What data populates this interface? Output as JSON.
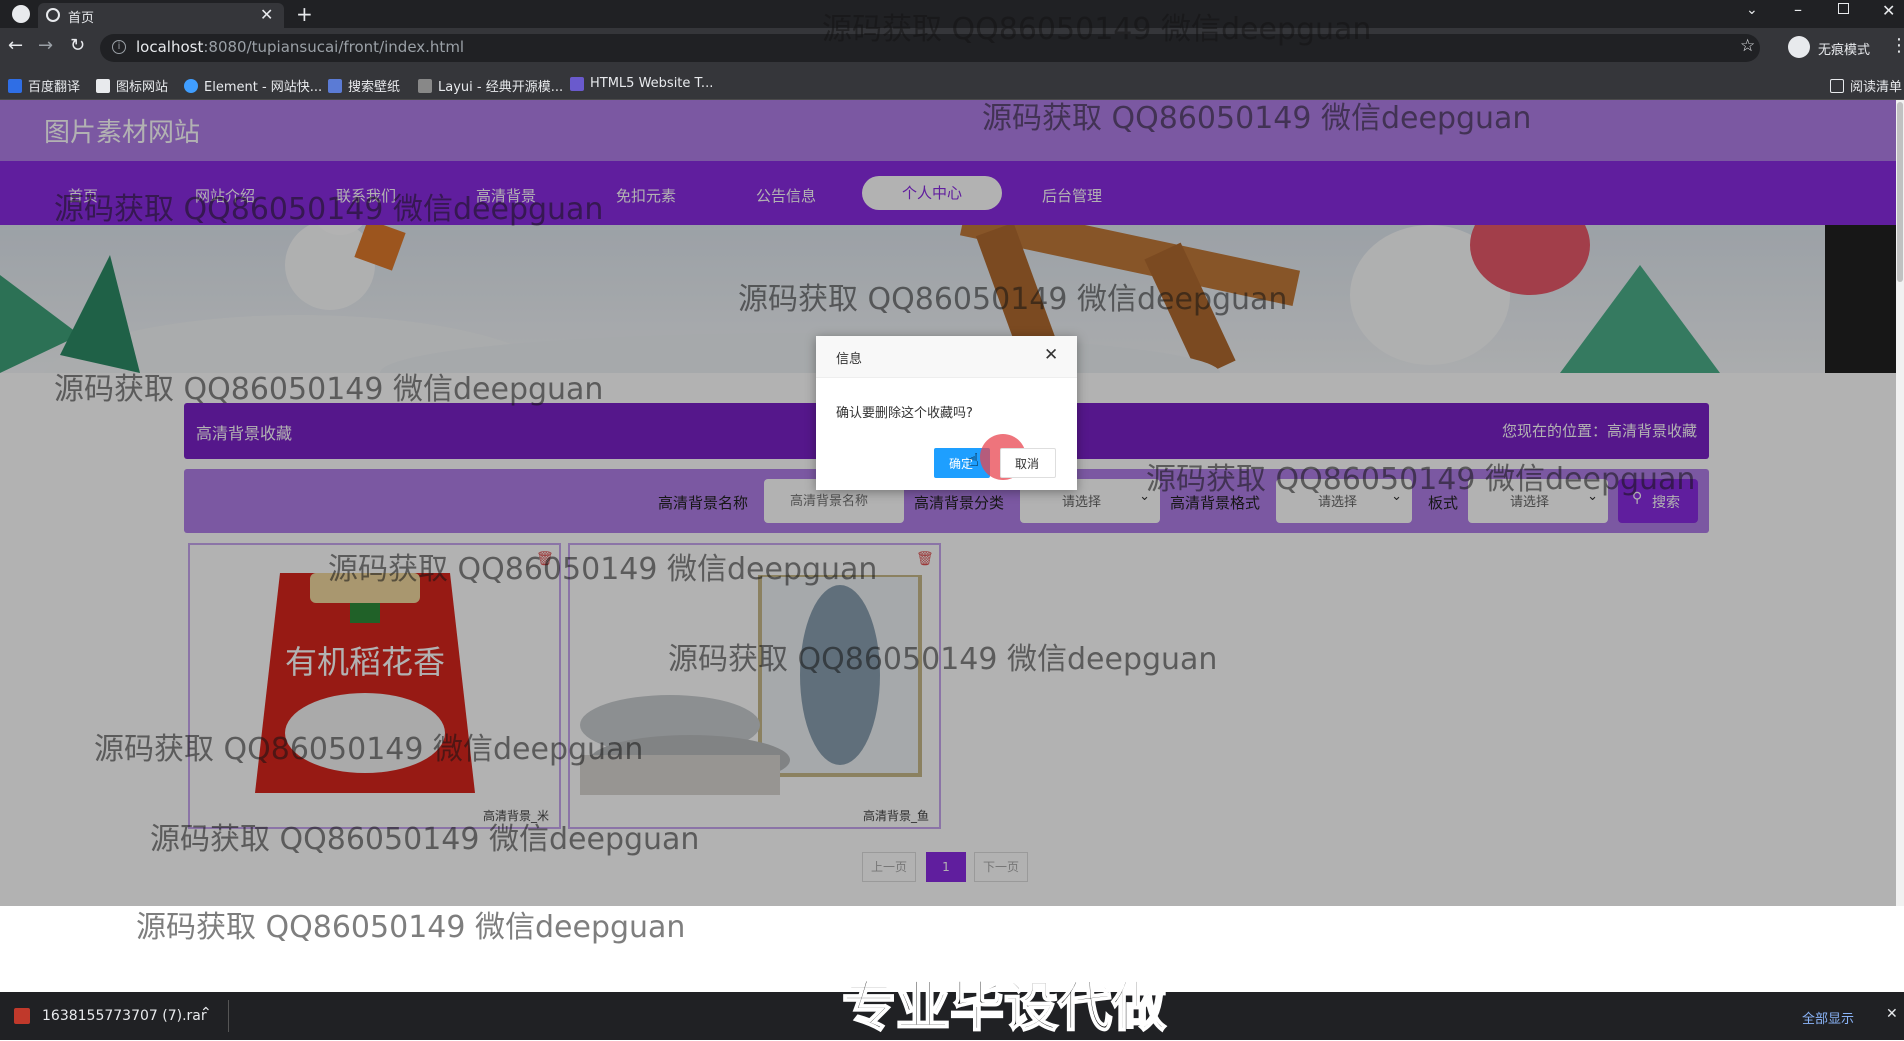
{
  "browser": {
    "tab_title": "首页",
    "url_host": "localhost",
    "url_rest": ":8080/tupiansucai/front/index.html",
    "profile_label": "无痕模式",
    "bookmarks": [
      "百度翻译",
      "图标网站",
      "Element - 网站快...",
      "搜索壁纸",
      "Layui - 经典开源模...",
      "HTML5 Website T..."
    ],
    "reading_list": "阅读清单"
  },
  "site": {
    "title": "图片素材网站",
    "nav": [
      "首页",
      "网站介绍",
      "联系我们",
      "高清背景",
      "免扣元素",
      "公告信息",
      "个人中心",
      "后台管理"
    ],
    "active_nav_index": 6
  },
  "section": {
    "title": "高清背景收藏",
    "breadcrumb_prefix": "您现在的位置：",
    "breadcrumb_current": "高清背景收藏"
  },
  "search": {
    "name_label": "高清背景名称",
    "name_placeholder": "高清背景名称",
    "category_label": "高清背景分类",
    "category_value": "请选择",
    "format_label": "高清背景格式",
    "format_value": "请选择",
    "style_label": "板式",
    "style_value": "请选择",
    "button_label": "搜索"
  },
  "cards": [
    {
      "caption": "高清背景_米",
      "image_text": "有机稻花香"
    },
    {
      "caption": "高清背景_鱼"
    }
  ],
  "pagination": {
    "prev": "上一页",
    "current": "1",
    "next": "下一页"
  },
  "dialog": {
    "title": "信息",
    "message": "确认要删除这个收藏吗?",
    "confirm": "确定",
    "cancel": "取消"
  },
  "download": {
    "filename": "1638155773707 (7).rar",
    "show_all": "全部显示"
  },
  "watermark": "源码获取 QQ86050149 微信deepguan",
  "caption_overlay": "专业毕设代做",
  "colors": {
    "header": "#b07ee8",
    "nav": "#8a2be2",
    "accent": "#7a22c8",
    "confirm_button": "#1e9fff"
  }
}
